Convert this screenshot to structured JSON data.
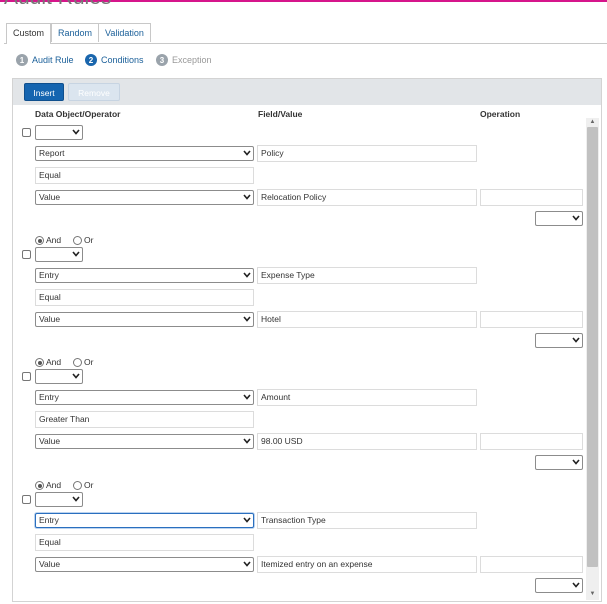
{
  "page": {
    "title": "Audit Rules",
    "accent": "#d6158b"
  },
  "tabs": [
    {
      "label": "Custom",
      "active": true
    },
    {
      "label": "Random",
      "active": false
    },
    {
      "label": "Validation",
      "active": false
    }
  ],
  "steps": [
    {
      "number": "1",
      "label": "Audit Rule",
      "state": "done"
    },
    {
      "number": "2",
      "label": "Conditions",
      "state": "current"
    },
    {
      "number": "3",
      "label": "Exception",
      "state": "disabled"
    }
  ],
  "toolbar": {
    "insert_label": "Insert",
    "remove_label": "Remove",
    "insert_color": "#1565b0"
  },
  "columns": {
    "data_object": "Data Object/Operator",
    "field_value": "Field/Value",
    "operation": "Operation"
  },
  "conditions": [
    {
      "logic": null,
      "object_select": "Report",
      "field": "Policy",
      "operator": "Equal",
      "value_select": "Value",
      "value": "Relocation Policy",
      "operation": ""
    },
    {
      "logic": {
        "and_label": "And",
        "or_label": "Or",
        "selected": "And"
      },
      "object_select": "Entry",
      "field": "Expense Type",
      "operator": "Equal",
      "value_select": "Value",
      "value": "Hotel",
      "operation": ""
    },
    {
      "logic": {
        "and_label": "And",
        "or_label": "Or",
        "selected": "And"
      },
      "object_select": "Entry",
      "field": "Amount",
      "operator": "Greater Than",
      "value_select": "Value",
      "value": "98.00 USD",
      "operation": ""
    },
    {
      "logic": {
        "and_label": "And",
        "or_label": "Or",
        "selected": "And"
      },
      "object_select": "Entry",
      "field": "Transaction Type",
      "operator": "Equal",
      "value_select": "Value",
      "value": "Itemized entry on an expense",
      "operation": ""
    }
  ]
}
